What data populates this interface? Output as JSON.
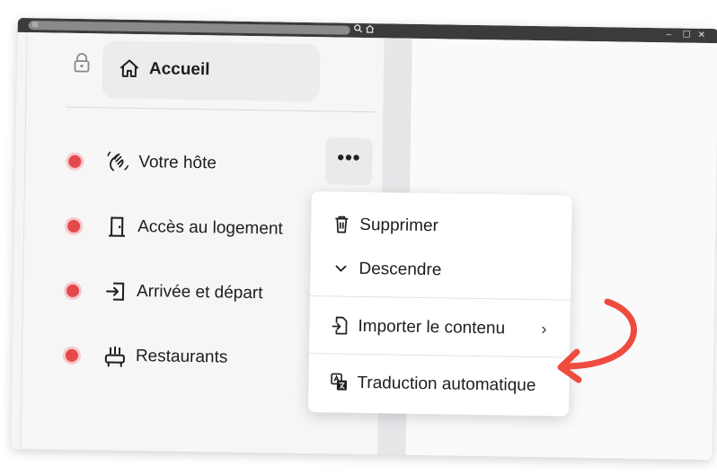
{
  "window": {
    "controls": {
      "minimize": "–",
      "maximize": "☐",
      "close": "✕"
    }
  },
  "sidebar": {
    "home": {
      "label": "Accueil"
    },
    "items": [
      {
        "label": "Votre hôte",
        "icon": "hand-wave-icon"
      },
      {
        "label": "Accès au logement",
        "icon": "door-icon"
      },
      {
        "label": "Arrivée et départ",
        "icon": "login-icon"
      },
      {
        "label": "Restaurants",
        "icon": "restaurant-icon"
      }
    ],
    "more_button": "•••"
  },
  "context_menu": {
    "items": [
      {
        "label": "Supprimer",
        "icon": "trash-icon"
      },
      {
        "label": "Descendre",
        "icon": "chevron-down-icon"
      },
      {
        "label": "Importer le contenu",
        "icon": "file-import-icon",
        "submenu_arrow": "›"
      },
      {
        "label": "Traduction automatique",
        "icon": "translate-icon"
      }
    ]
  },
  "colors": {
    "status_dot": "#e5484d",
    "annotation_arrow": "#ef4b3f",
    "titlebar": "#3b3b3d"
  }
}
